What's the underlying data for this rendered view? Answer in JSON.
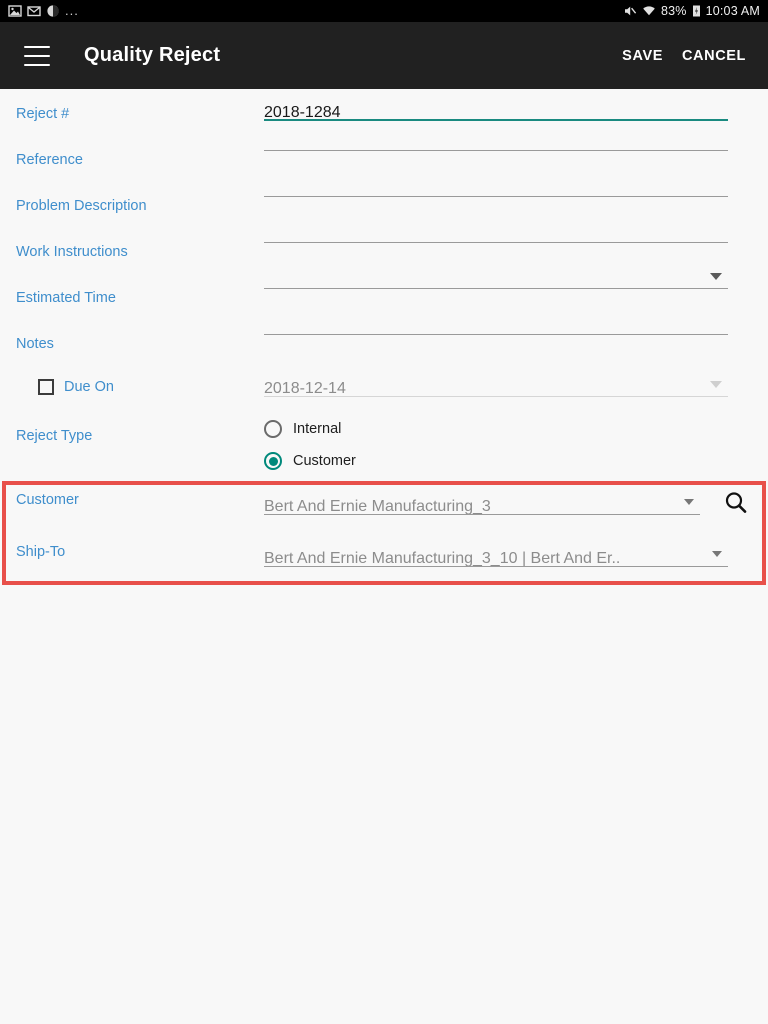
{
  "statusbar": {
    "left_icons": [
      "image-icon",
      "email-icon",
      "globe-icon"
    ],
    "overflow": "...",
    "right_icons": [
      "mute-icon",
      "wifi-icon",
      "battery-icon"
    ],
    "battery_percent": "83%",
    "time": "10:03 AM"
  },
  "appbar": {
    "menu_icon": "hamburger-menu-icon",
    "title": "Quality Reject",
    "save_label": "SAVE",
    "cancel_label": "CANCEL"
  },
  "form": {
    "rows": [
      {
        "label": "Reject #",
        "value": "2018-1284",
        "focused": true
      },
      {
        "label": "Reference",
        "value": ""
      },
      {
        "label": "Problem Description",
        "value": ""
      },
      {
        "label": "Work Instructions",
        "value": ""
      },
      {
        "label": "Estimated Time",
        "value": "",
        "dropdown": true
      },
      {
        "label": "Notes",
        "value": ""
      }
    ],
    "due_on": {
      "label": "Due On",
      "checked": false,
      "date": "2018-12-14"
    },
    "reject_type": {
      "label": "Reject Type",
      "options": [
        {
          "label": "Internal",
          "selected": false
        },
        {
          "label": "Customer",
          "selected": true
        }
      ]
    },
    "customer": {
      "label": "Customer",
      "value": "Bert And Ernie Manufacturing_3",
      "search_icon": "search-icon"
    },
    "ship_to": {
      "label": "Ship-To",
      "value": "Bert And Ernie Manufacturing_3_10 | Bert And Er.."
    }
  },
  "colors": {
    "accent_teal": "#00897b",
    "label_blue": "#3f8ecc",
    "highlight_red": "#e8504a",
    "appbar_dark": "#212121",
    "page_bg": "#f8f8f8"
  }
}
